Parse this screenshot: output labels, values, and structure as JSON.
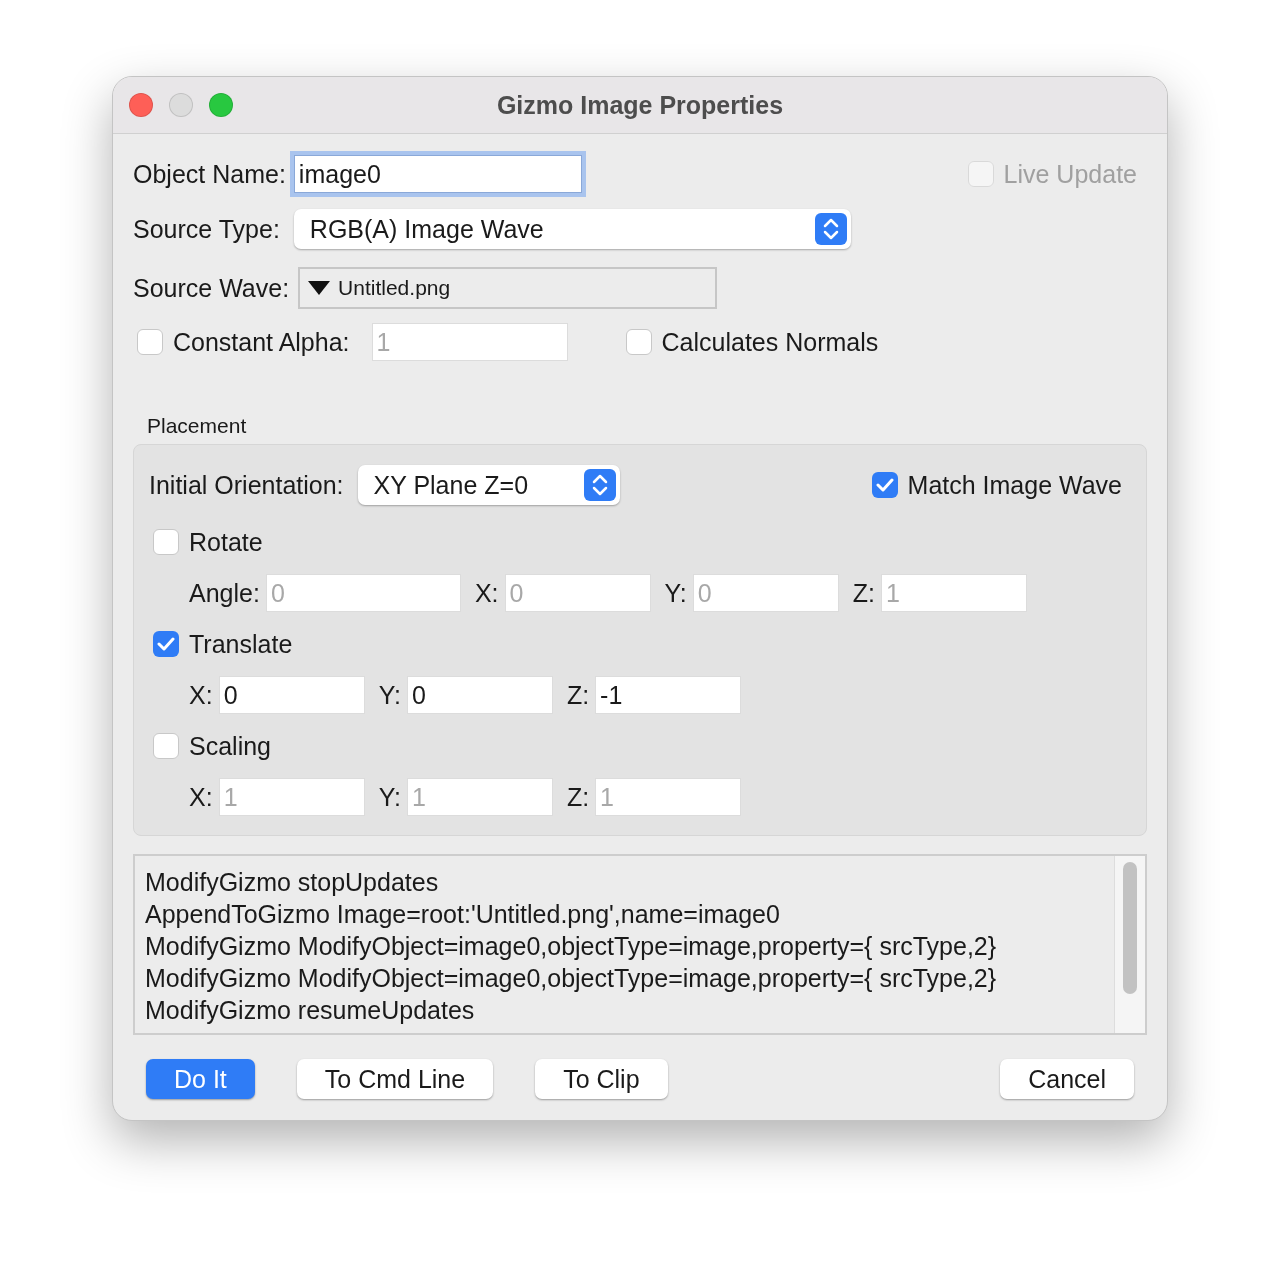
{
  "window": {
    "title": "Gizmo Image Properties"
  },
  "object_name": {
    "label": "Object Name:",
    "value": "image0",
    "focused": true
  },
  "live_update": {
    "label": "Live Update",
    "checked": false,
    "disabled": true
  },
  "source_type": {
    "label": "Source Type:",
    "value": "RGB(A) Image Wave"
  },
  "source_wave": {
    "label": "Source Wave:",
    "value": "Untitled.png"
  },
  "constant_alpha": {
    "label": "Constant Alpha:",
    "checked": false,
    "value": "1"
  },
  "calculates_normals": {
    "label": "Calculates Normals",
    "checked": false
  },
  "placement": {
    "title": "Placement",
    "orientation": {
      "label": "Initial Orientation:",
      "value": "XY Plane Z=0"
    },
    "match_image_wave": {
      "label": "Match Image Wave",
      "checked": true
    },
    "groups": [
      {
        "label": "Rotate",
        "checked": false,
        "fields": [
          {
            "label": "Angle:",
            "value": "0",
            "kind": "wide"
          },
          {
            "label": "X:",
            "value": "0",
            "kind": "normal"
          },
          {
            "label": "Y:",
            "value": "0",
            "kind": "normal"
          },
          {
            "label": "Z:",
            "value": "1",
            "kind": "normal"
          }
        ]
      },
      {
        "label": "Translate",
        "checked": true,
        "fields": [
          {
            "label": "X:",
            "value": "0",
            "kind": "normal"
          },
          {
            "label": "Y:",
            "value": "0",
            "kind": "normal"
          },
          {
            "label": "Z:",
            "value": "-1",
            "kind": "normal"
          }
        ]
      },
      {
        "label": "Scaling",
        "checked": false,
        "fields": [
          {
            "label": "X:",
            "value": "1",
            "kind": "normal"
          },
          {
            "label": "Y:",
            "value": "1",
            "kind": "normal"
          },
          {
            "label": "Z:",
            "value": "1",
            "kind": "normal"
          }
        ]
      }
    ]
  },
  "command_text": {
    "lines": [
      "ModifyGizmo stopUpdates",
      "AppendToGizmo Image=root:'Untitled.png',name=image0",
      "ModifyGizmo ModifyObject=image0,objectType=image,property={ srcType,2}",
      "ModifyGizmo ModifyObject=image0,objectType=image,property={ srcType,2}",
      "ModifyGizmo resumeUpdates"
    ]
  },
  "buttons": [
    {
      "label": "Do It",
      "kind": "default"
    },
    {
      "label": "To Cmd Line",
      "kind": "normal"
    },
    {
      "label": "To Clip",
      "kind": "normal"
    },
    {
      "label": "Cancel",
      "kind": "cancel"
    }
  ]
}
